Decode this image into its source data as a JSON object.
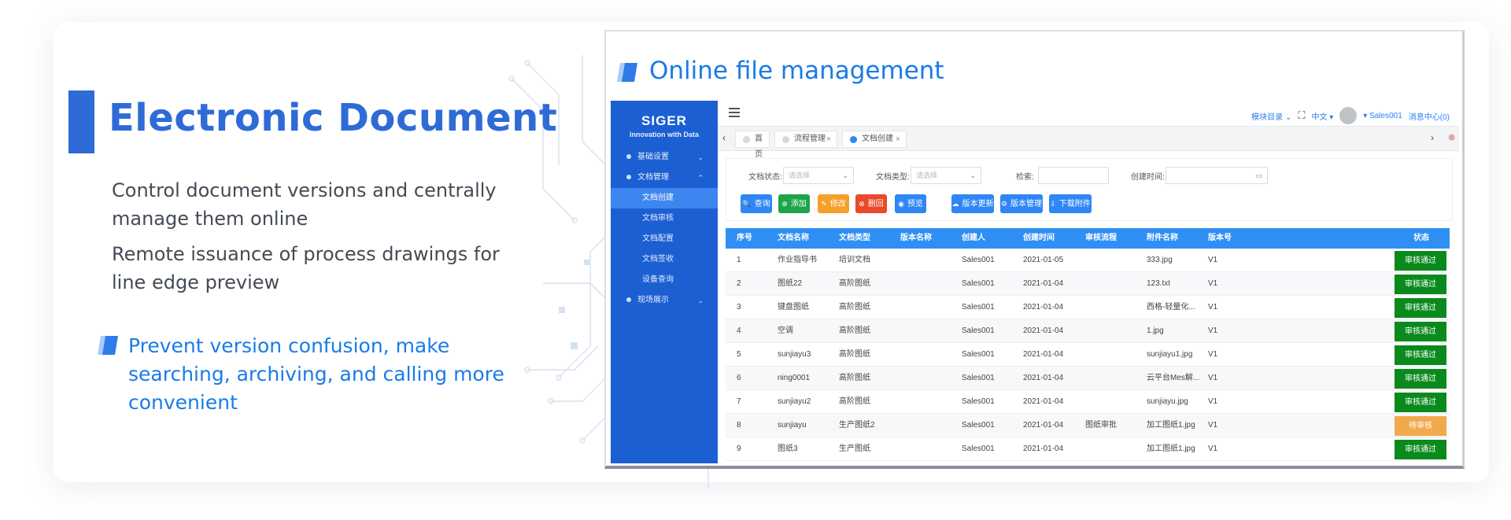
{
  "left": {
    "title": "Electronic Document",
    "desc1": "Control document versions and centrally manage them online",
    "desc2": "Remote issuance of process drawings for line edge preview",
    "highlight": "Prevent version confusion, make searching, archiving, and calling more convenient"
  },
  "screenshot": {
    "title": "Online file management"
  },
  "app": {
    "brand": "SIGER",
    "brand_sub": "Innovation with Data",
    "menu": [
      {
        "label": "基础设置",
        "chev": "⌄"
      },
      {
        "label": "文档管理",
        "chev": "⌃"
      },
      {
        "label": "现场展示",
        "chev": "⌄"
      }
    ],
    "submenu": [
      "文档创建",
      "文档审核",
      "文档配置",
      "文档签收",
      "设备查询"
    ],
    "topbar": {
      "module_menu": "模块目录 ⌄",
      "language": "中文 ▾",
      "user": "▾ Sales001",
      "messages": "消息中心(0)"
    },
    "tabs": [
      "首页",
      "流程管理",
      "文档创建"
    ],
    "filters": {
      "status_label": "文档状态:",
      "type_label": "文档类型:",
      "search_label": "检索:",
      "created_label": "创建时间:",
      "select_placeholder": "请选择"
    },
    "buttons": [
      {
        "label": "查询",
        "icon": "🔍"
      },
      {
        "label": "添加",
        "icon": "⊕"
      },
      {
        "label": "修改",
        "icon": "✎"
      },
      {
        "label": "删回",
        "icon": "⊗"
      },
      {
        "label": "预览",
        "icon": "◉"
      },
      {
        "label": "版本更新",
        "icon": "☁"
      },
      {
        "label": "版本管理",
        "icon": "⚙"
      },
      {
        "label": "下载附件",
        "icon": "⇩"
      }
    ],
    "columns": [
      "序号",
      "文档名称",
      "文档类型",
      "版本名称",
      "创建人",
      "创建时间",
      "审核流程",
      "附件名称",
      "版本号",
      "状态"
    ],
    "rows": [
      {
        "no": "1",
        "name": "作业指导书",
        "type": "培训文档",
        "ver_name": "",
        "creator": "Sales001",
        "date": "2021-01-05",
        "flow": "",
        "file": "333.jpg",
        "ver": "V1",
        "status": "审核通过",
        "pending": false
      },
      {
        "no": "2",
        "name": "图纸22",
        "type": "高阶图纸",
        "ver_name": "",
        "creator": "Sales001",
        "date": "2021-01-04",
        "flow": "",
        "file": "123.txt",
        "ver": "V1",
        "status": "审核通过",
        "pending": false
      },
      {
        "no": "3",
        "name": "键盘图纸",
        "type": "高阶图纸",
        "ver_name": "",
        "creator": "Sales001",
        "date": "2021-01-04",
        "flow": "",
        "file": "西格-轻量化...",
        "ver": "V1",
        "status": "审核通过",
        "pending": false
      },
      {
        "no": "4",
        "name": "空调",
        "type": "高阶图纸",
        "ver_name": "",
        "creator": "Sales001",
        "date": "2021-01-04",
        "flow": "",
        "file": "1.jpg",
        "ver": "V1",
        "status": "审核通过",
        "pending": false
      },
      {
        "no": "5",
        "name": "sunjiayu3",
        "type": "高阶图纸",
        "ver_name": "",
        "creator": "Sales001",
        "date": "2021-01-04",
        "flow": "",
        "file": "sunjiayu1.jpg",
        "ver": "V1",
        "status": "审核通过",
        "pending": false
      },
      {
        "no": "6",
        "name": "ning0001",
        "type": "高阶图纸",
        "ver_name": "",
        "creator": "Sales001",
        "date": "2021-01-04",
        "flow": "",
        "file": "云平台Mes解...",
        "ver": "V1",
        "status": "审核通过",
        "pending": false
      },
      {
        "no": "7",
        "name": "sunjiayu2",
        "type": "高阶图纸",
        "ver_name": "",
        "creator": "Sales001",
        "date": "2021-01-04",
        "flow": "",
        "file": "sunjiayu.jpg",
        "ver": "V1",
        "status": "审核通过",
        "pending": false
      },
      {
        "no": "8",
        "name": "sunjiayu",
        "type": "生产图纸2",
        "ver_name": "",
        "creator": "Sales001",
        "date": "2021-01-04",
        "flow": "图纸审批",
        "file": "加工图纸1.jpg",
        "ver": "V1",
        "status": "待审核",
        "pending": true
      },
      {
        "no": "9",
        "name": "图纸3",
        "type": "生产图纸",
        "ver_name": "",
        "creator": "Sales001",
        "date": "2021-01-04",
        "flow": "",
        "file": "加工图纸1.jpg",
        "ver": "V1",
        "status": "审核通过",
        "pending": false
      }
    ]
  },
  "colors": {
    "accent": "#2e6bd6",
    "link": "#1a7be8",
    "sidebar": "#1b5fd2",
    "table_header": "#2f8ff5",
    "approved": "#0a8a1c",
    "pending": "#f1a94b"
  }
}
